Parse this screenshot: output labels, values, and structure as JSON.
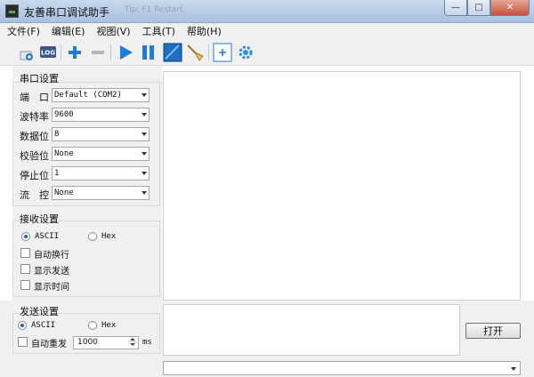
{
  "window": {
    "title": "友善串口调试助手",
    "ghost_title": "Tip: F1 Restart",
    "min_glyph": "—",
    "max_glyph": "□",
    "close_glyph": "✕"
  },
  "menu": {
    "items": [
      {
        "label": "文件(F)"
      },
      {
        "label": "编辑(E)"
      },
      {
        "label": "视图(V)"
      },
      {
        "label": "工具(T)"
      },
      {
        "label": "帮助(H)"
      }
    ]
  },
  "toolbar": {
    "log_label": "LOG",
    "icons": [
      "new-port-icon",
      "log-icon",
      "add-icon",
      "remove-icon",
      "play-icon",
      "pause-icon",
      "window-icon",
      "clear-broom-icon",
      "expand-panel-icon",
      "settings-gear-icon"
    ]
  },
  "serial_settings": {
    "title": "串口设置",
    "rows": [
      {
        "label": "端　口",
        "value": "Default (COM2)"
      },
      {
        "label": "波特率",
        "value": "9600"
      },
      {
        "label": "数据位",
        "value": "8"
      },
      {
        "label": "校验位",
        "value": "None"
      },
      {
        "label": "停止位",
        "value": "1"
      },
      {
        "label": "流　控",
        "value": "None"
      }
    ]
  },
  "receive_settings": {
    "title": "接收设置",
    "ascii_label": "ASCII",
    "hex_label": "Hex",
    "selected": "ASCII",
    "checks": [
      {
        "label": "自动换行",
        "checked": false
      },
      {
        "label": "显示发送",
        "checked": false
      },
      {
        "label": "显示时间",
        "checked": false
      }
    ]
  },
  "send_settings": {
    "title": "发送设置",
    "ascii_label": "ASCII",
    "hex_label": "Hex",
    "selected": "ASCII",
    "auto_resend_label": "自动重发",
    "auto_resend_checked": false,
    "interval_value": "1000",
    "interval_unit": "ms"
  },
  "actions": {
    "open_button": "打开"
  },
  "colors": {
    "accent_blue": "#1f7bd6",
    "titlebar": "#b7cce6"
  }
}
